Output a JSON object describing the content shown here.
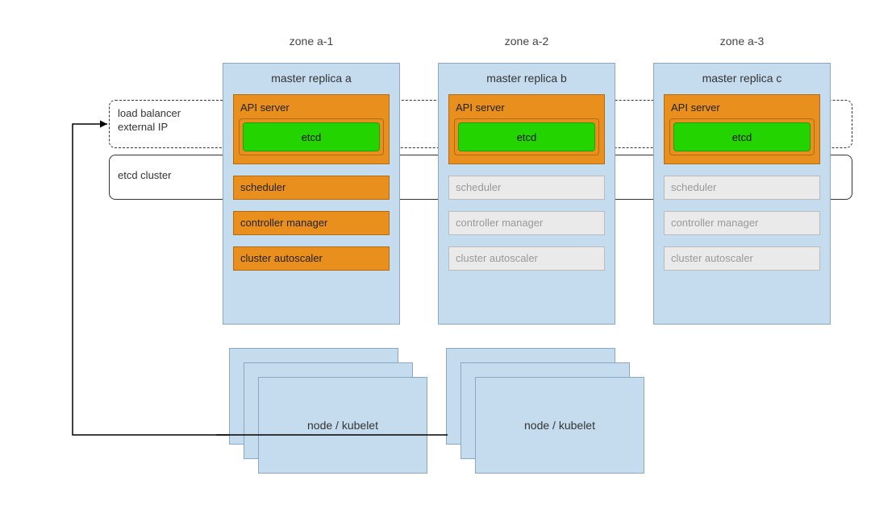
{
  "labels": {
    "load_balancer": "load balancer\nexternal IP",
    "etcd_cluster": "etcd cluster",
    "node_kubelet": "node / kubelet"
  },
  "api_server_label": "API server",
  "etcd_label": "etcd",
  "components": {
    "scheduler": "scheduler",
    "controller_manager": "controller manager",
    "cluster_autoscaler": "cluster autoscaler"
  },
  "zones": [
    {
      "name": "zone a-1",
      "replica_title": "master replica a",
      "active": true
    },
    {
      "name": "zone a-2",
      "replica_title": "master replica b",
      "active": false
    },
    {
      "name": "zone a-3",
      "replica_title": "master replica c",
      "active": false
    }
  ],
  "colors": {
    "panel_bg": "#c5dcee",
    "panel_border": "#8aa8bf",
    "active_bg": "#e98f1e",
    "active_border": "#b16b13",
    "inactive_bg": "#eaeaea",
    "inactive_text": "#999",
    "etcd_bg": "#23d400",
    "etcd_border": "#1aa000"
  }
}
